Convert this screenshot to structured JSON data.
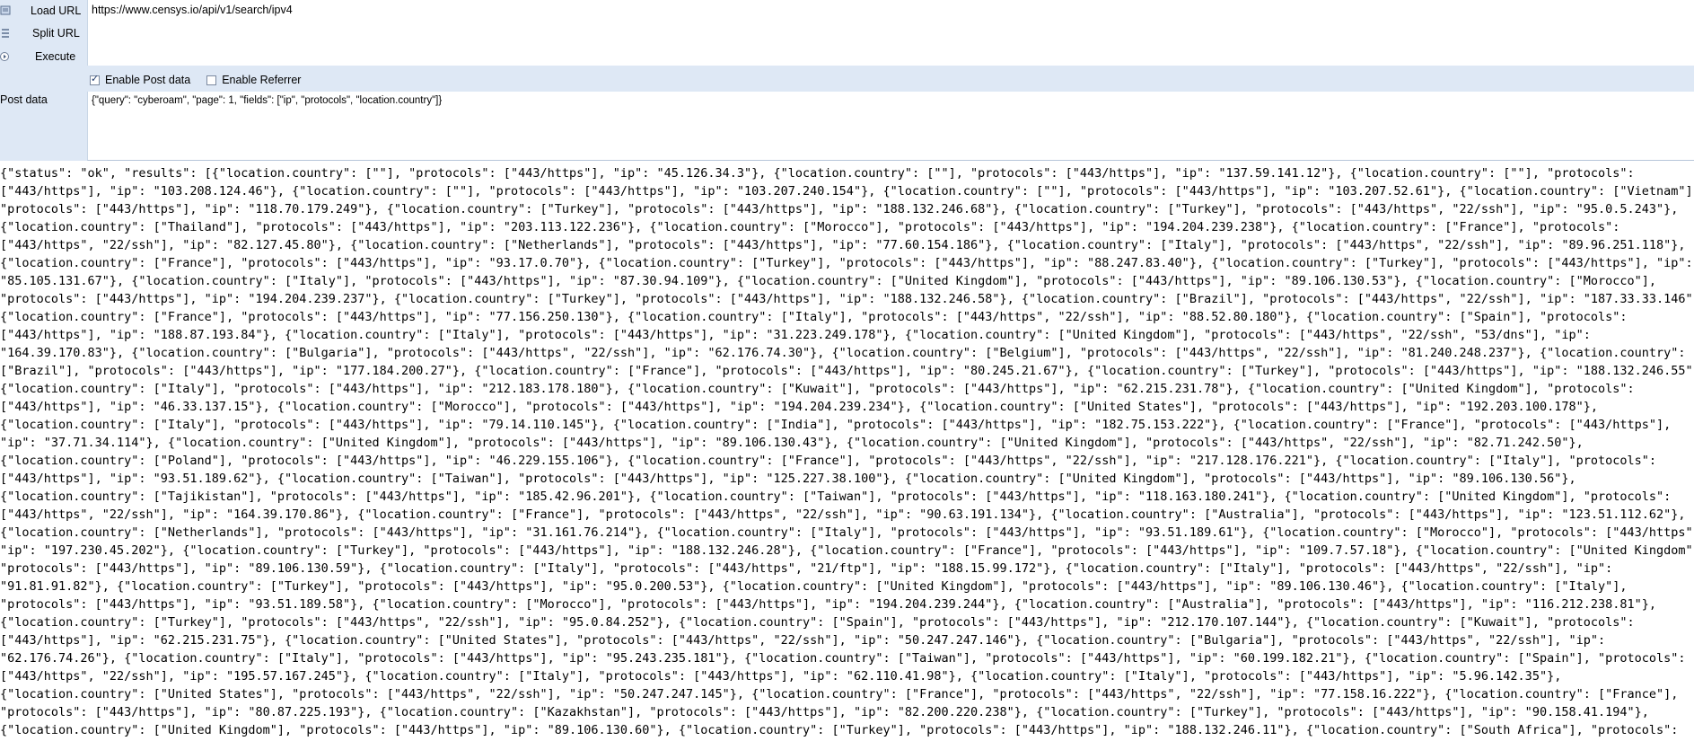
{
  "commands": {
    "load": "Load URL",
    "split": "Split URL",
    "execute": "Execute"
  },
  "url": "https://www.censys.io/api/v1/search/ipv4",
  "options": {
    "post": "Enable Post data",
    "post_checked": true,
    "referrer": "Enable Referrer",
    "referrer_checked": false
  },
  "post": {
    "label": "Post data",
    "value": "{\"query\": \"cyberoam\", \"page\": 1, \"fields\": [\"ip\", \"protocols\", \"location.country\"]}"
  },
  "response_lines": [
    "{\"status\": \"ok\", \"results\": [{\"location.country\": [\"\"], \"protocols\": [\"443/https\"], \"ip\": \"45.126.34.3\"}, {\"location.country\": [\"\"], \"protocols\": [\"443/https\"], \"ip\": \"137.59.141.12\"}, {\"location.country\": [\"\"], \"protocols\":",
    "[\"443/https\"], \"ip\": \"103.208.124.46\"}, {\"location.country\": [\"\"], \"protocols\": [\"443/https\"], \"ip\": \"103.207.240.154\"}, {\"location.country\": [\"\"], \"protocols\": [\"443/https\"], \"ip\": \"103.207.52.61\"}, {\"location.country\": [\"Vietnam\"],",
    "\"protocols\": [\"443/https\"], \"ip\": \"118.70.179.249\"}, {\"location.country\": [\"Turkey\"], \"protocols\": [\"443/https\"], \"ip\": \"188.132.246.68\"}, {\"location.country\": [\"Turkey\"], \"protocols\": [\"443/https\", \"22/ssh\"], \"ip\": \"95.0.5.243\"},",
    "{\"location.country\": [\"Thailand\"], \"protocols\": [\"443/https\"], \"ip\": \"203.113.122.236\"}, {\"location.country\": [\"Morocco\"], \"protocols\": [\"443/https\"], \"ip\": \"194.204.239.238\"}, {\"location.country\": [\"France\"], \"protocols\":",
    "[\"443/https\", \"22/ssh\"], \"ip\": \"82.127.45.80\"}, {\"location.country\": [\"Netherlands\"], \"protocols\": [\"443/https\"], \"ip\": \"77.60.154.186\"}, {\"location.country\": [\"Italy\"], \"protocols\": [\"443/https\", \"22/ssh\"], \"ip\": \"89.96.251.118\"},",
    "{\"location.country\": [\"France\"], \"protocols\": [\"443/https\"], \"ip\": \"93.17.0.70\"}, {\"location.country\": [\"Turkey\"], \"protocols\": [\"443/https\"], \"ip\": \"88.247.83.40\"}, {\"location.country\": [\"Turkey\"], \"protocols\": [\"443/https\"], \"ip\":",
    "\"85.105.131.67\"}, {\"location.country\": [\"Italy\"], \"protocols\": [\"443/https\"], \"ip\": \"87.30.94.109\"}, {\"location.country\": [\"United Kingdom\"], \"protocols\": [\"443/https\"], \"ip\": \"89.106.130.53\"}, {\"location.country\": [\"Morocco\"],",
    "\"protocols\": [\"443/https\"], \"ip\": \"194.204.239.237\"}, {\"location.country\": [\"Turkey\"], \"protocols\": [\"443/https\"], \"ip\": \"188.132.246.58\"}, {\"location.country\": [\"Brazil\"], \"protocols\": [\"443/https\", \"22/ssh\"], \"ip\": \"187.33.33.146\"},",
    "{\"location.country\": [\"France\"], \"protocols\": [\"443/https\"], \"ip\": \"77.156.250.130\"}, {\"location.country\": [\"Italy\"], \"protocols\": [\"443/https\", \"22/ssh\"], \"ip\": \"88.52.80.180\"}, {\"location.country\": [\"Spain\"], \"protocols\":",
    "[\"443/https\"], \"ip\": \"188.87.193.84\"}, {\"location.country\": [\"Italy\"], \"protocols\": [\"443/https\"], \"ip\": \"31.223.249.178\"}, {\"location.country\": [\"United Kingdom\"], \"protocols\": [\"443/https\", \"22/ssh\", \"53/dns\"], \"ip\":",
    "\"164.39.170.83\"}, {\"location.country\": [\"Bulgaria\"], \"protocols\": [\"443/https\", \"22/ssh\"], \"ip\": \"62.176.74.30\"}, {\"location.country\": [\"Belgium\"], \"protocols\": [\"443/https\", \"22/ssh\"], \"ip\": \"81.240.248.237\"}, {\"location.country\":",
    "[\"Brazil\"], \"protocols\": [\"443/https\"], \"ip\": \"177.184.200.27\"}, {\"location.country\": [\"France\"], \"protocols\": [\"443/https\"], \"ip\": \"80.245.21.67\"}, {\"location.country\": [\"Turkey\"], \"protocols\": [\"443/https\"], \"ip\": \"188.132.246.55\"},",
    "{\"location.country\": [\"Italy\"], \"protocols\": [\"443/https\"], \"ip\": \"212.183.178.180\"}, {\"location.country\": [\"Kuwait\"], \"protocols\": [\"443/https\"], \"ip\": \"62.215.231.78\"}, {\"location.country\": [\"United Kingdom\"], \"protocols\":",
    "[\"443/https\"], \"ip\": \"46.33.137.15\"}, {\"location.country\": [\"Morocco\"], \"protocols\": [\"443/https\"], \"ip\": \"194.204.239.234\"}, {\"location.country\": [\"United States\"], \"protocols\": [\"443/https\"], \"ip\": \"192.203.100.178\"},",
    "{\"location.country\": [\"Italy\"], \"protocols\": [\"443/https\"], \"ip\": \"79.14.110.145\"}, {\"location.country\": [\"India\"], \"protocols\": [\"443/https\"], \"ip\": \"182.75.153.222\"}, {\"location.country\": [\"France\"], \"protocols\": [\"443/https\"],",
    "\"ip\": \"37.71.34.114\"}, {\"location.country\": [\"United Kingdom\"], \"protocols\": [\"443/https\"], \"ip\": \"89.106.130.43\"}, {\"location.country\": [\"United Kingdom\"], \"protocols\": [\"443/https\", \"22/ssh\"], \"ip\": \"82.71.242.50\"},",
    "{\"location.country\": [\"Poland\"], \"protocols\": [\"443/https\"], \"ip\": \"46.229.155.106\"}, {\"location.country\": [\"France\"], \"protocols\": [\"443/https\", \"22/ssh\"], \"ip\": \"217.128.176.221\"}, {\"location.country\": [\"Italy\"], \"protocols\":",
    "[\"443/https\"], \"ip\": \"93.51.189.62\"}, {\"location.country\": [\"Taiwan\"], \"protocols\": [\"443/https\"], \"ip\": \"125.227.38.100\"}, {\"location.country\": [\"United Kingdom\"], \"protocols\": [\"443/https\"], \"ip\": \"89.106.130.56\"},",
    "{\"location.country\": [\"Tajikistan\"], \"protocols\": [\"443/https\"], \"ip\": \"185.42.96.201\"}, {\"location.country\": [\"Taiwan\"], \"protocols\": [\"443/https\"], \"ip\": \"118.163.180.241\"}, {\"location.country\": [\"United Kingdom\"], \"protocols\":",
    "[\"443/https\", \"22/ssh\"], \"ip\": \"164.39.170.86\"}, {\"location.country\": [\"France\"], \"protocols\": [\"443/https\", \"22/ssh\"], \"ip\": \"90.63.191.134\"}, {\"location.country\": [\"Australia\"], \"protocols\": [\"443/https\"], \"ip\": \"123.51.112.62\"},",
    "{\"location.country\": [\"Netherlands\"], \"protocols\": [\"443/https\"], \"ip\": \"31.161.76.214\"}, {\"location.country\": [\"Italy\"], \"protocols\": [\"443/https\"], \"ip\": \"93.51.189.61\"}, {\"location.country\": [\"Morocco\"], \"protocols\": [\"443/https\"],",
    "\"ip\": \"197.230.45.202\"}, {\"location.country\": [\"Turkey\"], \"protocols\": [\"443/https\"], \"ip\": \"188.132.246.28\"}, {\"location.country\": [\"France\"], \"protocols\": [\"443/https\"], \"ip\": \"109.7.57.18\"}, {\"location.country\": [\"United Kingdom\"],",
    "\"protocols\": [\"443/https\"], \"ip\": \"89.106.130.59\"}, {\"location.country\": [\"Italy\"], \"protocols\": [\"443/https\", \"21/ftp\"], \"ip\": \"188.15.99.172\"}, {\"location.country\": [\"Italy\"], \"protocols\": [\"443/https\", \"22/ssh\"], \"ip\":",
    "\"91.81.91.82\"}, {\"location.country\": [\"Turkey\"], \"protocols\": [\"443/https\"], \"ip\": \"95.0.200.53\"}, {\"location.country\": [\"United Kingdom\"], \"protocols\": [\"443/https\"], \"ip\": \"89.106.130.46\"}, {\"location.country\": [\"Italy\"],",
    "\"protocols\": [\"443/https\"], \"ip\": \"93.51.189.58\"}, {\"location.country\": [\"Morocco\"], \"protocols\": [\"443/https\"], \"ip\": \"194.204.239.244\"}, {\"location.country\": [\"Australia\"], \"protocols\": [\"443/https\"], \"ip\": \"116.212.238.81\"},",
    "{\"location.country\": [\"Turkey\"], \"protocols\": [\"443/https\", \"22/ssh\"], \"ip\": \"95.0.84.252\"}, {\"location.country\": [\"Spain\"], \"protocols\": [\"443/https\"], \"ip\": \"212.170.107.144\"}, {\"location.country\": [\"Kuwait\"], \"protocols\":",
    "[\"443/https\"], \"ip\": \"62.215.231.75\"}, {\"location.country\": [\"United States\"], \"protocols\": [\"443/https\", \"22/ssh\"], \"ip\": \"50.247.247.146\"}, {\"location.country\": [\"Bulgaria\"], \"protocols\": [\"443/https\", \"22/ssh\"], \"ip\":",
    "\"62.176.74.26\"}, {\"location.country\": [\"Italy\"], \"protocols\": [\"443/https\"], \"ip\": \"95.243.235.181\"}, {\"location.country\": [\"Taiwan\"], \"protocols\": [\"443/https\"], \"ip\": \"60.199.182.21\"}, {\"location.country\": [\"Spain\"], \"protocols\":",
    "[\"443/https\", \"22/ssh\"], \"ip\": \"195.57.167.245\"}, {\"location.country\": [\"Italy\"], \"protocols\": [\"443/https\"], \"ip\": \"62.110.41.98\"}, {\"location.country\": [\"Italy\"], \"protocols\": [\"443/https\"], \"ip\": \"5.96.142.35\"},",
    "{\"location.country\": [\"United States\"], \"protocols\": [\"443/https\", \"22/ssh\"], \"ip\": \"50.247.247.145\"}, {\"location.country\": [\"France\"], \"protocols\": [\"443/https\", \"22/ssh\"], \"ip\": \"77.158.16.222\"}, {\"location.country\": [\"France\"],",
    "\"protocols\": [\"443/https\"], \"ip\": \"80.87.225.193\"}, {\"location.country\": [\"Kazakhstan\"], \"protocols\": [\"443/https\"], \"ip\": \"82.200.220.238\"}, {\"location.country\": [\"Turkey\"], \"protocols\": [\"443/https\"], \"ip\": \"90.158.41.194\"},",
    "{\"location.country\": [\"United Kingdom\"], \"protocols\": [\"443/https\"], \"ip\": \"89.106.130.60\"}, {\"location.country\": [\"Turkey\"], \"protocols\": [\"443/https\"], \"ip\": \"188.132.246.11\"}, {\"location.country\": [\"South Africa\"], \"protocols\":"
  ],
  "colors": {
    "panel_bg": "#dee8f5",
    "text": "#000000"
  }
}
